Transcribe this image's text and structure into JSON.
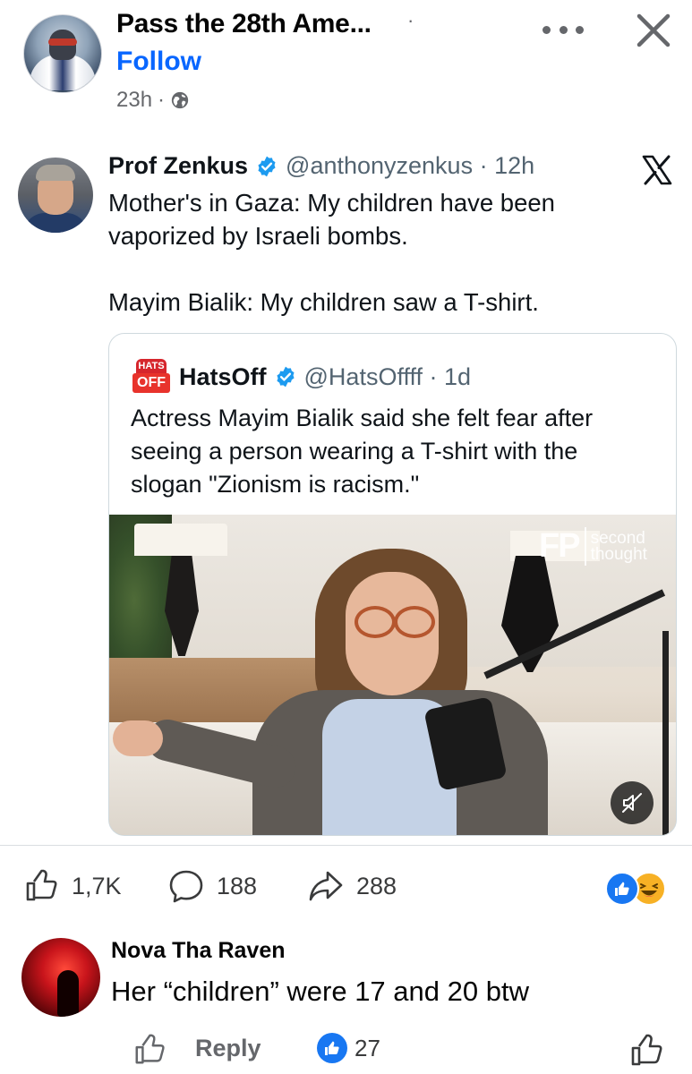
{
  "post_header": {
    "page_name": "Pass the 28th Ame...",
    "separator": "·",
    "follow_label": "Follow",
    "time": "23h",
    "time_separator": "·",
    "privacy_icon": "globe-icon",
    "more_icon": "more-icon",
    "close_icon": "close-icon"
  },
  "tweet": {
    "author_name": "Prof Zenkus",
    "verified_icon": "verified-badge-icon",
    "handle_time": "@anthonyzenkus · 12h",
    "platform_icon": "x-logo-icon",
    "lines": [
      "Mother's in Gaza: My children have been",
      "vaporized by Israeli bombs.",
      "Mayim Bialik: My children saw a T-shirt."
    ],
    "quote": {
      "logo_top": "HATS",
      "logo_bottom": "OFF",
      "author_name": "HatsOff",
      "handle_time": "@HatsOffff · 1d",
      "lines": [
        "Actress Mayim Bialik said she felt fear after",
        "seeing a person wearing a T-shirt with the",
        "slogan \"Zionism is racism.\""
      ],
      "video": {
        "watermark_brand": "FP",
        "watermark_text_1": "second",
        "watermark_text_2": "thought",
        "mute_icon": "muted-speaker-icon"
      }
    }
  },
  "stats": {
    "likes": "1,7K",
    "comments": "188",
    "shares": "288",
    "reaction_icons": [
      "like-reaction-icon",
      "haha-reaction-icon"
    ]
  },
  "comment": {
    "author": "Nova Tha Raven",
    "text": "Her “children” were 17 and 20 btw",
    "reply_label": "Reply",
    "like_count": "27"
  },
  "colors": {
    "accent_blue": "#0866ff",
    "text_primary": "#050505",
    "text_secondary": "#65676b",
    "x_secondary": "#536471",
    "verified_blue": "#1d9bf0",
    "facebook_blue": "#1877f2"
  }
}
